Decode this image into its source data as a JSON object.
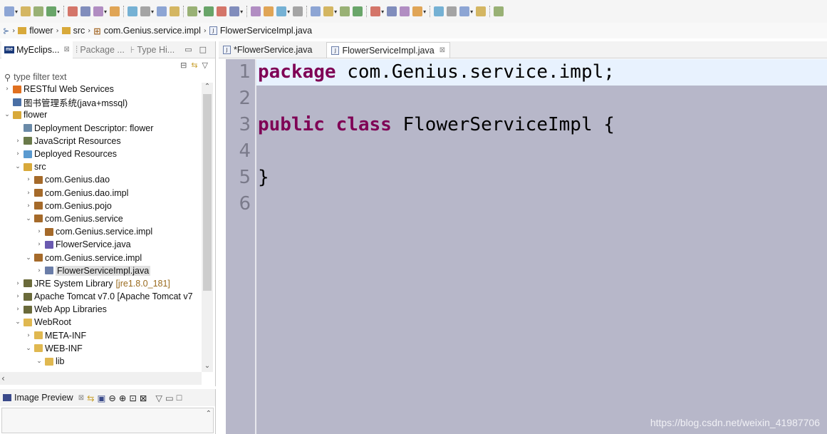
{
  "toolbar": {
    "icons": [
      "new-icon",
      "save-icon",
      "save-all-icon",
      "terminal-icon",
      "cut-icon",
      "undo-icon",
      "redo-icon",
      "open-type-icon",
      "debug-icon",
      "toggle-breakpoint-icon",
      "grid-icon",
      "pin-icon",
      "highlight-icon",
      "annotation-icon",
      "show-whitespace-icon",
      "block-select-icon",
      "search-icon",
      "globe-icon",
      "server-icon",
      "run-settings-icon",
      "run-icon",
      "debug-run-icon",
      "external-tools-icon",
      "new-java-project-icon",
      "new-package-icon",
      "new-class-icon",
      "open-folder-icon",
      "brush-icon",
      "folder-icon",
      "next-annotation-icon",
      "prev-annotation-icon",
      "back-icon",
      "forward-icon"
    ]
  },
  "breadcrumb": {
    "items": [
      "flower",
      "src",
      "com.Genius.service.impl",
      "FlowerServiceImpl.java"
    ]
  },
  "explorer": {
    "tabs": [
      {
        "label": "MyEclips...",
        "close": "⊠"
      },
      {
        "label": "Package ...",
        "close": ""
      },
      {
        "label": "Type Hi...",
        "close": ""
      }
    ],
    "filter_placeholder": "type filter text",
    "tree": [
      {
        "label": "RESTful Web Services",
        "depth": 0,
        "twisty": "›",
        "icon": "rest-icon",
        "color": "#e07020"
      },
      {
        "label": "图书管理系统(java+mssql)",
        "depth": 0,
        "twisty": "",
        "icon": "project-icon",
        "color": "#4a6fa5"
      },
      {
        "label": "flower",
        "depth": 0,
        "twisty": "⌄",
        "icon": "web-project-icon",
        "color": "#d8a93a"
      },
      {
        "label": "Deployment Descriptor: flower",
        "depth": 1,
        "twisty": "",
        "icon": "descriptor-icon",
        "color": "#6a8aa8"
      },
      {
        "label": "JavaScript Resources",
        "depth": 1,
        "twisty": "›",
        "icon": "js-resources-icon",
        "color": "#6a7a4a"
      },
      {
        "label": "Deployed Resources",
        "depth": 1,
        "twisty": "›",
        "icon": "deployed-icon",
        "color": "#5a9ad0"
      },
      {
        "label": "src",
        "depth": 1,
        "twisty": "⌄",
        "icon": "source-folder-icon",
        "color": "#d8a93a"
      },
      {
        "label": "com.Genius.dao",
        "depth": 2,
        "twisty": "›",
        "icon": "package-icon",
        "color": "#a56a2a"
      },
      {
        "label": "com.Genius.dao.impl",
        "depth": 2,
        "twisty": "›",
        "icon": "package-icon",
        "color": "#a56a2a"
      },
      {
        "label": "com.Genius.pojo",
        "depth": 2,
        "twisty": "›",
        "icon": "package-icon",
        "color": "#a56a2a"
      },
      {
        "label": "com.Genius.service",
        "depth": 2,
        "twisty": "⌄",
        "icon": "package-icon",
        "color": "#a56a2a"
      },
      {
        "label": "com.Genius.service.impl",
        "depth": 3,
        "twisty": "›",
        "icon": "package-icon",
        "color": "#a56a2a"
      },
      {
        "label": "FlowerService.java",
        "depth": 3,
        "twisty": "›",
        "icon": "java-interface-icon",
        "color": "#6a5ab0"
      },
      {
        "label": "com.Genius.service.impl",
        "depth": 2,
        "twisty": "⌄",
        "icon": "package-icon",
        "color": "#a56a2a"
      },
      {
        "label": "FlowerServiceImpl.java",
        "depth": 3,
        "twisty": "›",
        "icon": "java-file-icon",
        "color": "#6a7da8",
        "selected": true
      },
      {
        "label": "JRE System Library",
        "decor": "[jre1.8.0_181]",
        "depth": 1,
        "twisty": "›",
        "icon": "library-icon",
        "color": "#6a6a3a"
      },
      {
        "label": "Apache Tomcat v7.0 [Apache Tomcat v7",
        "depth": 1,
        "twisty": "›",
        "icon": "library-icon",
        "color": "#6a6a3a"
      },
      {
        "label": "Web App Libraries",
        "depth": 1,
        "twisty": "›",
        "icon": "library-icon",
        "color": "#6a6a3a"
      },
      {
        "label": "WebRoot",
        "depth": 1,
        "twisty": "⌄",
        "icon": "folder-icon",
        "color": "#e0b850"
      },
      {
        "label": "META-INF",
        "depth": 2,
        "twisty": "›",
        "icon": "folder-icon",
        "color": "#e0b850"
      },
      {
        "label": "WEB-INF",
        "depth": 2,
        "twisty": "⌄",
        "icon": "folder-icon",
        "color": "#e0b850"
      },
      {
        "label": "lib",
        "depth": 3,
        "twisty": "⌄",
        "icon": "folder-icon",
        "color": "#e0b850"
      }
    ]
  },
  "preview": {
    "title": "Image Preview"
  },
  "editor": {
    "tabs": [
      {
        "label": "*FlowerService.java",
        "active": false
      },
      {
        "label": "FlowerServiceImpl.java",
        "active": true,
        "close": "⊠"
      }
    ],
    "lines": [
      {
        "num": "1",
        "kw": "package",
        "rest": " com.Genius.service.impl;"
      },
      {
        "num": "2",
        "kw": "",
        "rest": ""
      },
      {
        "num": "3",
        "kw": "public class",
        "rest": " FlowerServiceImpl {"
      },
      {
        "num": "4",
        "kw": "",
        "rest": ""
      },
      {
        "num": "5",
        "kw": "",
        "rest": "}"
      },
      {
        "num": "6",
        "kw": "",
        "rest": ""
      }
    ],
    "watermark": "https://blog.csdn.net/weixin_41987706"
  },
  "colors": {
    "editor_bg": "#b7b7c9",
    "current_line": "#e8f2fe",
    "keyword": "#7f0055"
  }
}
